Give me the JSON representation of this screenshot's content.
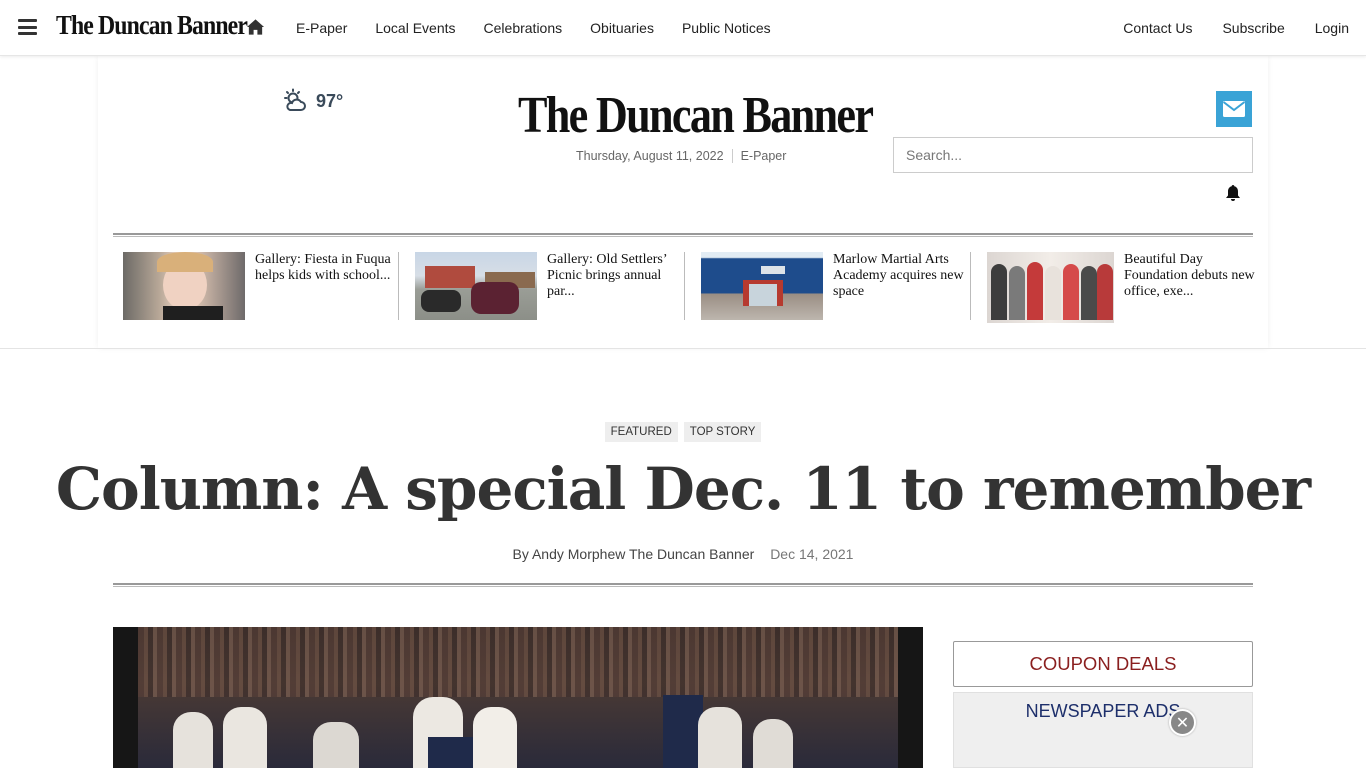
{
  "topnav": {
    "logo": "The Duncan Banner",
    "links": [
      "E-Paper",
      "Local Events",
      "Celebrations",
      "Obituaries",
      "Public Notices"
    ],
    "right_links": [
      "Contact Us",
      "Subscribe",
      "Login"
    ]
  },
  "masthead": {
    "weather_temp": "97°",
    "logo": "The Duncan Banner",
    "date": "Thursday, August 11, 2022",
    "epaper": "E-Paper",
    "search_placeholder": "Search..."
  },
  "headlines": [
    {
      "title": "Gallery: Fiesta in Fuqua helps kids with school..."
    },
    {
      "title": "Gallery: Old Settlers’ Picnic brings annual par..."
    },
    {
      "title": "Marlow Martial Arts Academy acquires new space"
    },
    {
      "title": "Beautiful Day Foundation debuts new office, exe..."
    }
  ],
  "article": {
    "tags": [
      "FEATURED",
      "TOP STORY"
    ],
    "headline": "Column: A special Dec. 11 to remember",
    "author": "By Andy Morphew The Duncan Banner",
    "date": "Dec 14, 2021"
  },
  "sidebar": {
    "coupon_label": "COUPON DEALS",
    "ads_label": "NEWSPAPER ADS"
  },
  "colors": {
    "mail_button": "#3aa3d6",
    "coupon_text": "#8a1f1f",
    "ads_text": "#1d2f6b"
  }
}
